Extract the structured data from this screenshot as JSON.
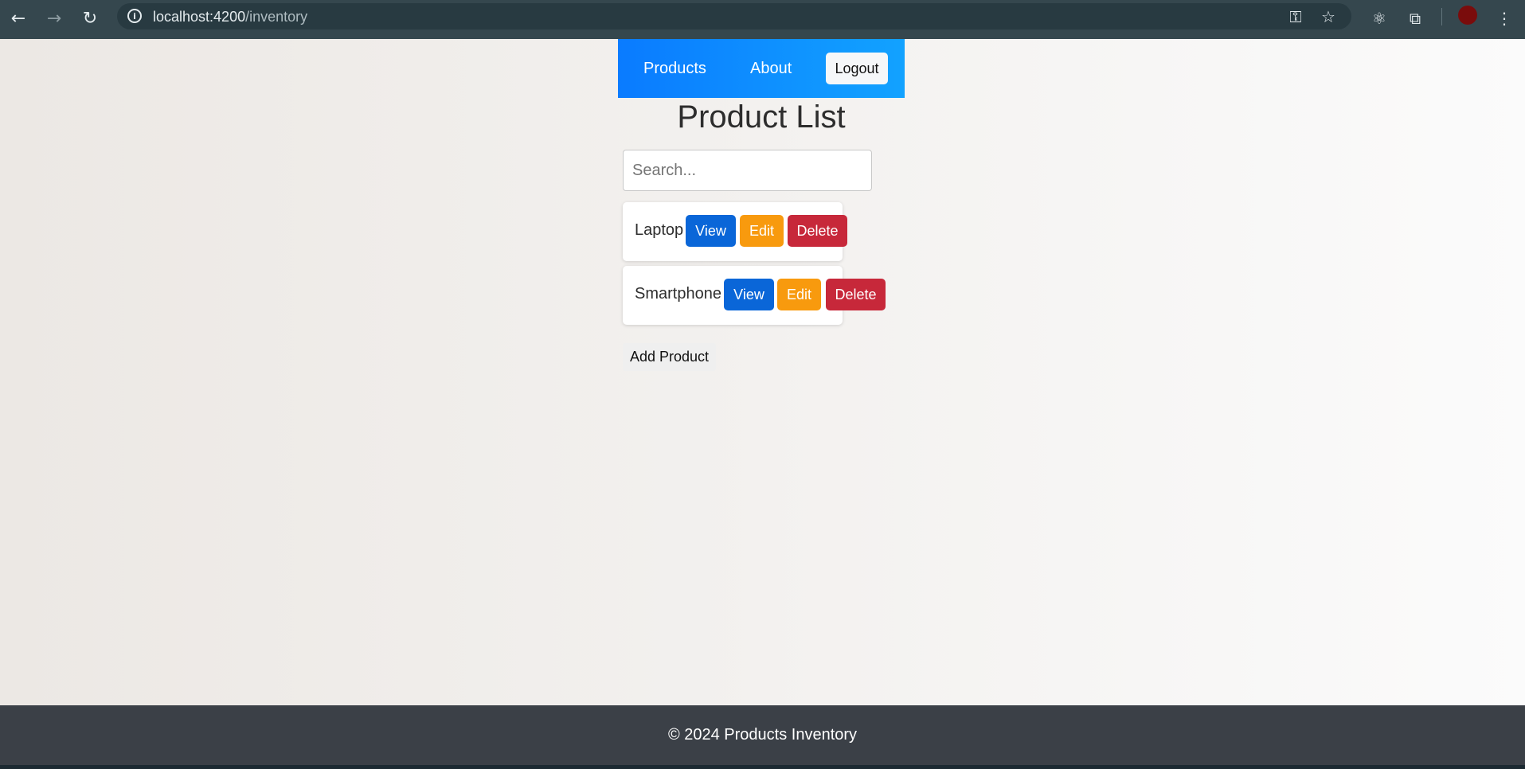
{
  "browser": {
    "url_host": "localhost:4200",
    "url_path": "/inventory",
    "icons": {
      "back": "back-arrow-icon",
      "forward": "forward-arrow-icon",
      "reload": "reload-icon",
      "site_info": "info-icon",
      "password": "key-icon",
      "bookmark": "star-icon",
      "react_devtools": "react-icon",
      "extensions": "puzzle-icon",
      "menu": "kebab-menu-icon"
    },
    "profile_color": "#7a0c0c"
  },
  "navbar": {
    "products_label": "Products",
    "about_label": "About",
    "logout_label": "Logout"
  },
  "page": {
    "title": "Product List",
    "search_placeholder": "Search...",
    "products": [
      {
        "name": "Laptop",
        "view_label": "View",
        "edit_label": "Edit",
        "delete_label": "Delete"
      },
      {
        "name": "Smartphone",
        "view_label": "View",
        "edit_label": "Edit",
        "delete_label": "Delete"
      }
    ],
    "add_product_label": "Add Product"
  },
  "footer": {
    "text": "© 2024 Products Inventory"
  },
  "colors": {
    "navbar_start": "#0a7bff",
    "navbar_end": "#12a2ff",
    "view_button": "#0a66d8",
    "edit_button": "#f89a0e",
    "delete_button": "#c7283a",
    "footer_bg": "#3b4047"
  }
}
